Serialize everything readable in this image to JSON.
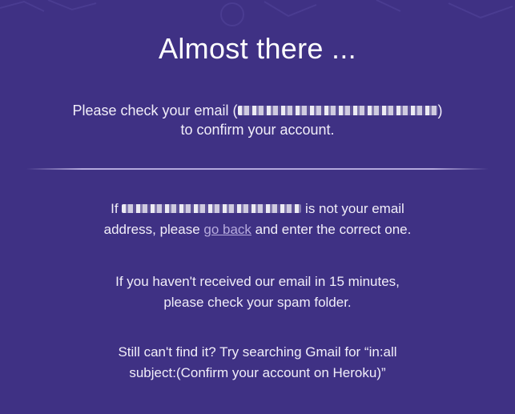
{
  "page": {
    "title": "Almost there ...",
    "confirm": {
      "line1_prefix": "Please check your email (",
      "line1_suffix": ")",
      "line2": "to confirm your account."
    },
    "wrong_email": {
      "prefix": "If ",
      "suffix": " is not your email",
      "line2_prefix": "address, please ",
      "link_label": "go back",
      "line2_suffix": " and enter the correct one."
    },
    "spam": {
      "line1": "If you haven't received our email in 15 minutes,",
      "line2": "please check your spam folder."
    },
    "search": {
      "line1": "Still can't find it? Try searching Gmail for “in:all",
      "line2": "subject:(Confirm your account on Heroku)”"
    }
  },
  "colors": {
    "background": "#3f3184",
    "text": "#ffffff",
    "link": "#b6abdd"
  }
}
